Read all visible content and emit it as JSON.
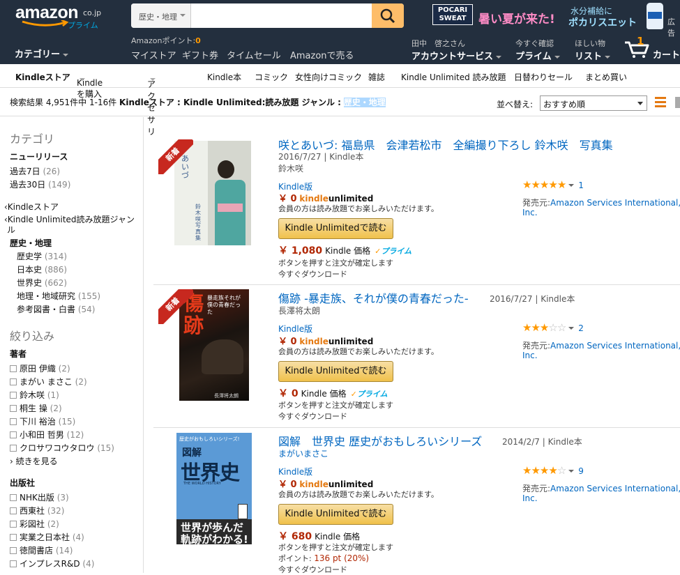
{
  "header": {
    "logo_main": "amazon",
    "logo_domain": "co.jp",
    "logo_sub": "プライム",
    "search_category": "歴史・地理",
    "search_value": "",
    "ad_brand_1": "POCARI",
    "ad_brand_2": "SWEAT",
    "ad_text_1": "暑い夏が来た!",
    "ad_text_2": "水分補給に",
    "ad_text_3": "ポカリスエット",
    "ad_tag": "広告",
    "categories_label": "カテゴリー",
    "points_label": "Amazonポイント:",
    "points_value": "0",
    "nav_links": [
      "マイストア",
      "ギフト券",
      "タイムセール",
      "Amazonで売る"
    ],
    "account_greeting": "田中　啓之さん",
    "account_label": "アカウントサービス",
    "prime_small": "今すぐ確認",
    "prime_label": "プライム",
    "wishlist_small": "ほしい物",
    "wishlist_label": "リスト",
    "cart_count": "1",
    "cart_label": "カート"
  },
  "subnav": [
    "Kindleストア",
    "Kindle を購入",
    "アクセサリ",
    "Kindle本",
    "コミック",
    "女性向けコミック",
    "雑誌",
    "Kindle Unlimited 読み放題",
    "日替わりセール",
    "まとめ買い"
  ],
  "results": {
    "prefix": "検索結果 4,951件中 1-16件",
    "path": "Kindleストア : Kindle Unlimited:読み放題 ジャンル :",
    "highlight": "歴史・地理",
    "sort_label": "並べ替え:",
    "sort_value": "おすすめ順"
  },
  "sidebar": {
    "category_heading": "カテゴリ",
    "new_release": "ニューリリース",
    "last7": "過去7日",
    "last7_count": "(26)",
    "last30": "過去30日",
    "last30_count": "(149)",
    "back1": "‹Kindleストア",
    "back2a": "‹Kindle Unlimited読み放題ジャン",
    "back2b": "ル",
    "current": "歴史・地理",
    "subcats": [
      {
        "label": "歴史学",
        "count": "(314)"
      },
      {
        "label": "日本史",
        "count": "(886)"
      },
      {
        "label": "世界史",
        "count": "(662)"
      },
      {
        "label": "地理・地域研究",
        "count": "(155)"
      },
      {
        "label": "参考図書・白書",
        "count": "(54)"
      }
    ],
    "refine_heading": "絞り込み",
    "author_heading": "著者",
    "authors": [
      {
        "label": "原田 伊織",
        "count": "(2)"
      },
      {
        "label": "まがい まさこ",
        "count": "(2)"
      },
      {
        "label": "鈴木咲",
        "count": "(1)"
      },
      {
        "label": "桐生 操",
        "count": "(2)"
      },
      {
        "label": "下川 裕治",
        "count": "(15)"
      },
      {
        "label": "小和田 哲男",
        "count": "(12)"
      },
      {
        "label": "クロサワコウタロウ",
        "count": "(15)"
      }
    ],
    "see_more": "› 続きを見る",
    "publisher_heading": "出版社",
    "publishers": [
      {
        "label": "NHK出版",
        "count": "(3)"
      },
      {
        "label": "西東社",
        "count": "(32)"
      },
      {
        "label": "彩図社",
        "count": "(2)"
      },
      {
        "label": "実業之日本社",
        "count": "(4)"
      },
      {
        "label": "徳間書店",
        "count": "(14)"
      },
      {
        "label": "インプレスR&D",
        "count": "(4)"
      }
    ]
  },
  "items": [
    {
      "new_badge": "新着",
      "title": "咲とあいづ: 福島県　会津若松市　全編撮り下ろし 鈴木咲　写真集",
      "date_format": "2016/7/27 | Kindle本",
      "author": "鈴木咲",
      "format": "Kindle版",
      "ku_price": "￥ 0",
      "ku_note": "会員の方は読み放題でお楽しみいただけます。",
      "button": "Kindle Unlimitedで読む",
      "price": "￥ 1,080",
      "price_label": "Kindle 価格",
      "prime": "プライム",
      "confirm": "ボタンを押すと注文が確定します",
      "download": "今すぐダウンロード",
      "rating": 5,
      "review_count": "1",
      "publisher_label": "発売元:",
      "publisher": "Amazon Services International,",
      "publisher_2": "Inc.",
      "cover_text_1": "あいづ",
      "cover_text_2": "鈴木咲　写真集"
    },
    {
      "new_badge": "新着",
      "title": "傷跡 -暴走族、それが僕の青春だった-",
      "date_format": "2016/7/27 | Kindle本",
      "author": "長澤将太朗",
      "format": "Kindle版",
      "ku_price": "￥ 0",
      "ku_note": "会員の方は読み放題でお楽しみいただけます。",
      "button": "Kindle Unlimitedで読む",
      "price": "￥ 0",
      "price_label": "Kindle 価格",
      "prime": "プライム",
      "confirm": "ボタンを押すと注文が確定します",
      "download": "今すぐダウンロード",
      "rating": 3,
      "review_count": "2",
      "publisher_label": "発売元:",
      "publisher": "Amazon Services International,",
      "publisher_2": "Inc.",
      "cover_text_1": "傷跡",
      "cover_text_2": "暴走族それが僕の青春だった",
      "cover_text_3": "長澤将太朗"
    },
    {
      "title": "図解　世界史 歴史がおもしろいシリーズ",
      "date_format": "2014/2/7 | Kindle本",
      "author": "まがいまさこ",
      "format": "Kindle版",
      "ku_price": "￥ 0",
      "ku_note": "会員の方は読み放題でお楽しみいただけます。",
      "button": "Kindle Unlimitedで読む",
      "price": "￥ 680",
      "price_label": "Kindle 価格",
      "confirm": "ボタンを押すと注文が確定します",
      "points_label": "ポイント:",
      "points_value": "136 pt (20%)",
      "download": "今すぐダウンロード",
      "rating": 4,
      "review_count": "9",
      "publisher_label": "発売元:",
      "publisher": "Amazon Services International,",
      "publisher_2": "Inc.",
      "cover_text_1": "歴史がおもしろいシリーズ!",
      "cover_text_2": "図解",
      "cover_text_3": "世界史",
      "cover_text_4": "THE WORLD HISTORY",
      "cover_text_5": "世界が歩んだ",
      "cover_text_6": "軌跡がわかる!"
    }
  ],
  "colors": {
    "header_bg": "#232f3e",
    "search_button": "#febd69",
    "link": "#0066c0",
    "price": "#b12704",
    "star": "#ff9900",
    "button": "#f0c14b",
    "highlight": "#add8ff"
  }
}
